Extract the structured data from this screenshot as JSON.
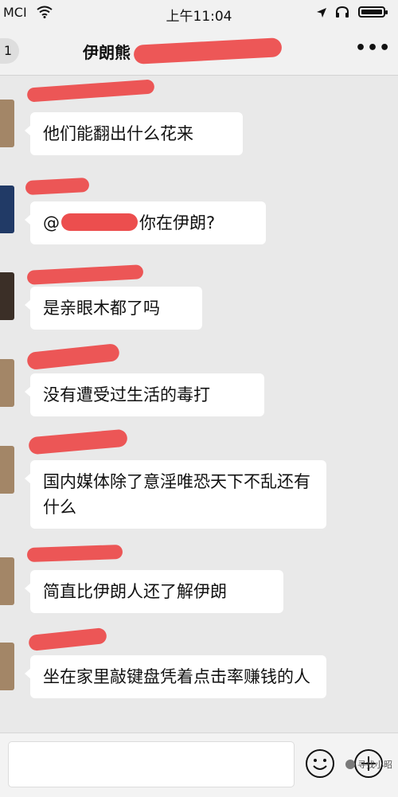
{
  "status_bar": {
    "carrier": "MCI",
    "time": "上午11:04"
  },
  "nav": {
    "back_label": "1",
    "title": "伊朗熊",
    "more_label": "•••"
  },
  "messages": [
    {
      "text": "他们能翻出什么花来"
    },
    {
      "text_prefix": "@",
      "text_suffix": "你在伊朗?"
    },
    {
      "text": "是亲眼木都了吗"
    },
    {
      "text": "没有遭受过生活的毒打"
    },
    {
      "text": "国内媒体除了意淫唯恐天下不乱还有什么"
    },
    {
      "text": "简直比伊朗人还了解伊朗"
    },
    {
      "text": "坐在家里敲键盘凭着点击率赚钱的人"
    }
  ],
  "input_bar": {
    "placeholder": ""
  },
  "watermark": {
    "text": "寻找小昭"
  },
  "colors": {
    "redaction": "#ec4e4e",
    "bubble": "#ffffff",
    "background": "#e9e9e9"
  }
}
